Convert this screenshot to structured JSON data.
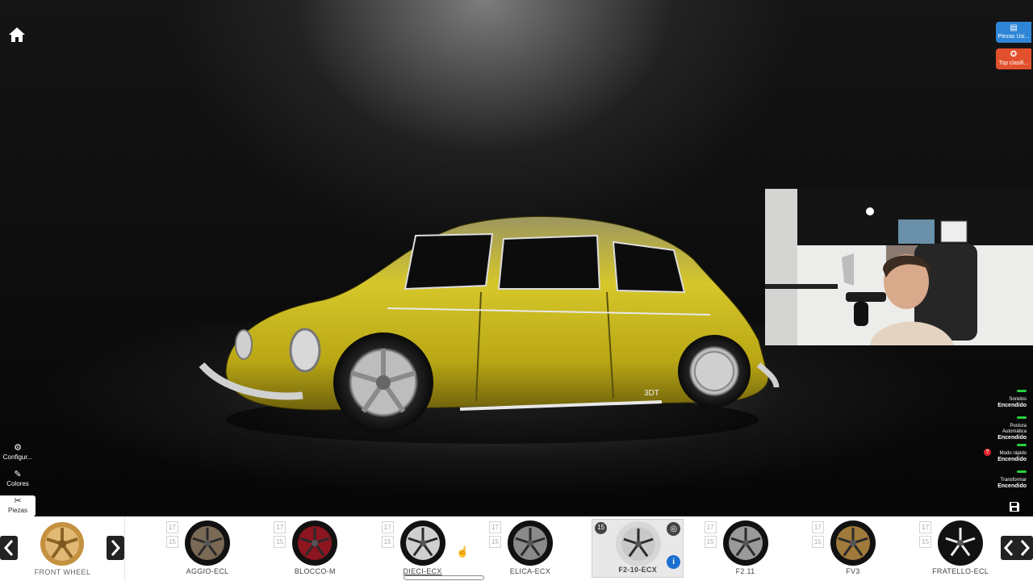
{
  "top_buttons": [
    {
      "label": "Piezas Usi...",
      "icon": "document-icon",
      "color": "#2f86d6"
    },
    {
      "label": "Top clasifi...",
      "icon": "medal-icon",
      "color": "#e2502e"
    }
  ],
  "left_menu": [
    {
      "label": "Configur...",
      "icon": "gears-icon"
    },
    {
      "label": "Colores",
      "icon": "brush-icon"
    },
    {
      "label": "Piezas",
      "icon": "tools-icon",
      "active": true
    }
  ],
  "toggles": [
    {
      "label": "Sonidos",
      "state": "Encendido"
    },
    {
      "label": "Postura Automática",
      "state": "Encendido"
    },
    {
      "label": "Modo rápido",
      "state": "Encendido",
      "badge": "?"
    },
    {
      "label": "Transformar",
      "state": "Encendido"
    }
  ],
  "save_icon": "save-icon",
  "car": {
    "badge_text": "3DT"
  },
  "wheel_strip": {
    "current": {
      "label": "FRONT WHEEL"
    },
    "items": [
      {
        "name": "AGGIO-ECL",
        "sizes": [
          "17",
          "15"
        ],
        "rim_color": "#7a6a55"
      },
      {
        "name": "BLOCCO-M",
        "sizes": [
          "17",
          "15"
        ],
        "rim_color": "#8c1520"
      },
      {
        "name": "DIECI-ECX",
        "sizes": [
          "17",
          "15"
        ],
        "rim_color": "#cfcfcf",
        "hovered": true
      },
      {
        "name": "ELICA-ECX",
        "sizes": [
          "17",
          "15"
        ],
        "rim_color": "#8a8a8a"
      },
      {
        "name": "F2-10-ECX",
        "sizes": [
          "15"
        ],
        "rim_color": "#c8c8c8",
        "selected": true
      },
      {
        "name": "F2.11",
        "sizes": [
          "17",
          "15"
        ],
        "rim_color": "#9a9a9a"
      },
      {
        "name": "FV3",
        "sizes": [
          "17",
          "15"
        ],
        "rim_color": "#a07a3a"
      },
      {
        "name": "FRATELLO-ECL",
        "sizes": [
          "17",
          "15"
        ],
        "rim_color": "#111111"
      }
    ]
  },
  "colors": {
    "toggle_on": "#27d13e",
    "car_body": "#c9b620",
    "strip_bg": "#ffffff",
    "info": "#1a6fd0"
  }
}
